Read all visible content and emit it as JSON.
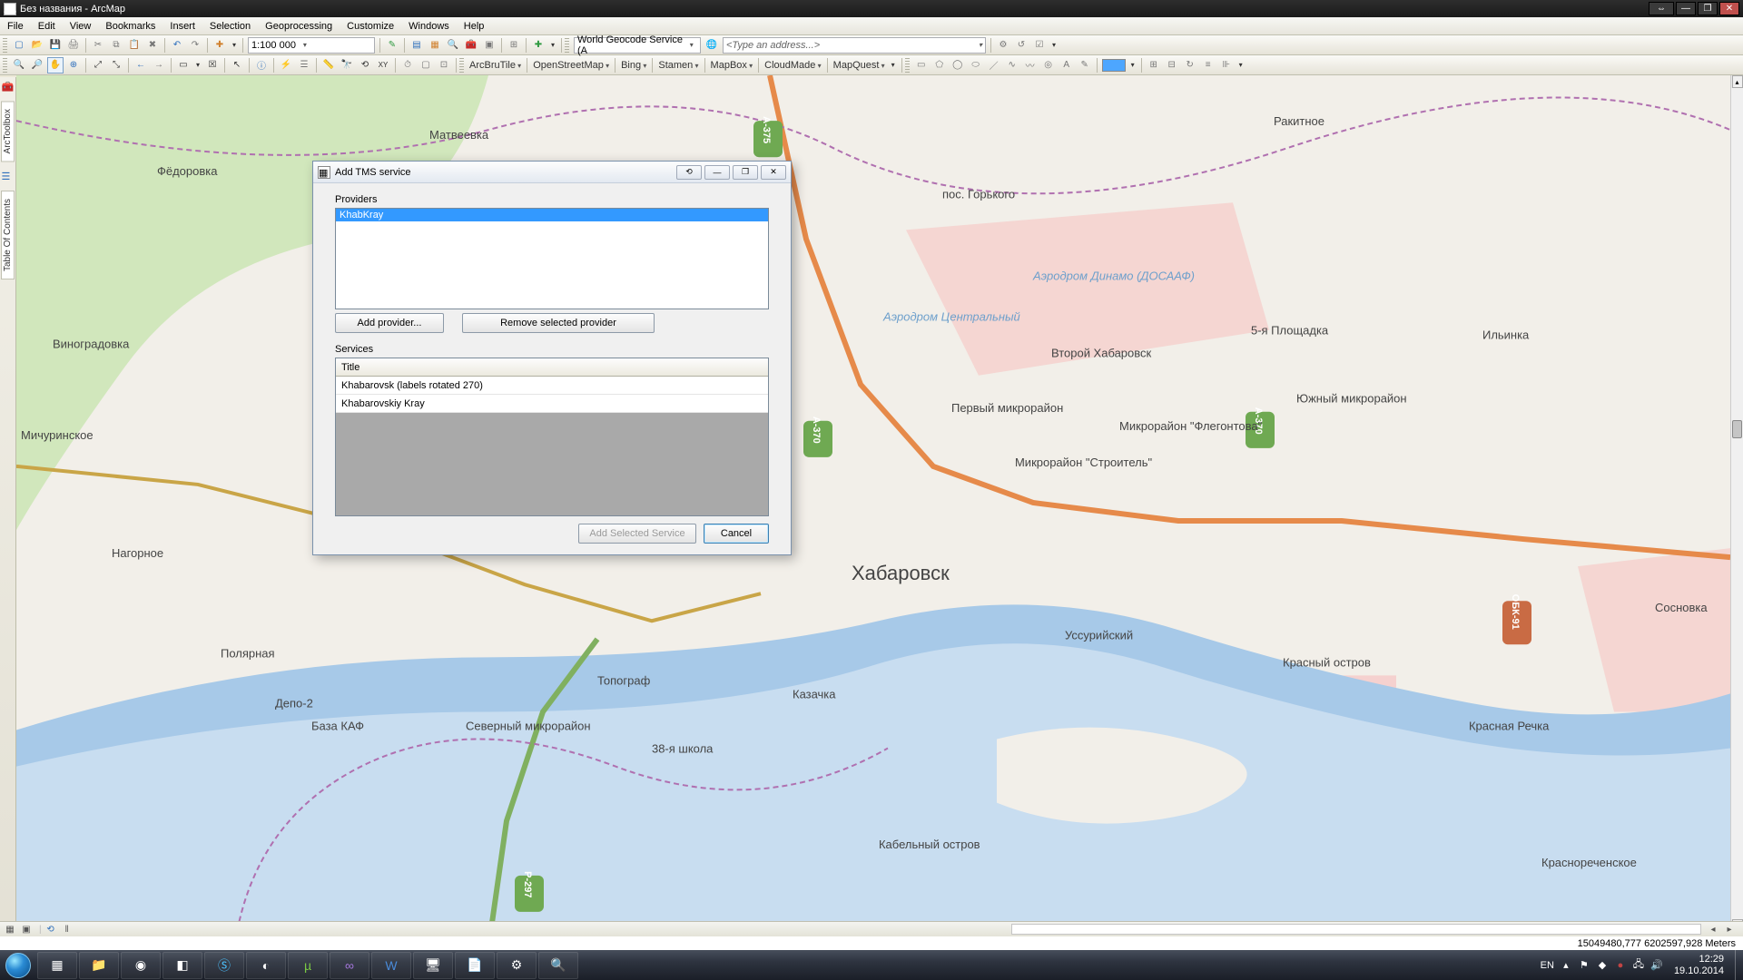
{
  "window": {
    "title": "Без названия - ArcMap"
  },
  "menubar": [
    "File",
    "Edit",
    "View",
    "Bookmarks",
    "Insert",
    "Selection",
    "Geoprocessing",
    "Customize",
    "Windows",
    "Help"
  ],
  "toolbar1": {
    "scale": "1:100 000",
    "geocode_service": "World Geocode Service (A",
    "address_placeholder": "<Type an address...>"
  },
  "toolbar2": {
    "menus": [
      "ArcBruTile",
      "OpenStreetMap",
      "Bing",
      "Stamen",
      "MapBox",
      "CloudMade",
      "MapQuest"
    ]
  },
  "side": {
    "tab1": "ArcToolbox",
    "tab2": "Table Of Contents"
  },
  "dialog": {
    "title": "Add TMS service",
    "providers_label": "Providers",
    "providers": [
      "KhabKray"
    ],
    "add_provider": "Add provider...",
    "remove_provider": "Remove selected provider",
    "services_label": "Services",
    "grid_header": "Title",
    "services": [
      "Khabarovsk (labels rotated 270)",
      "Khabarovskiy Kray"
    ],
    "add_selected": "Add Selected Service",
    "cancel": "Cancel"
  },
  "map_labels": {
    "city": "Хабаровск",
    "places": {
      "matveevka": "Матвеевка",
      "fedorovka": "Фёдоровка",
      "vinogradovka": "Виноградовка",
      "michurinskoe": "Мичуринское",
      "nagornoe": "Нагорное",
      "polyarnaya": "Полярная",
      "depo2": "Депо-2",
      "baza_kaf": "База КАФ",
      "severny": "Северный микрорайон",
      "school38": "38-я школа",
      "topograf": "Топограф",
      "kazachka": "Казачка",
      "ussuriyskiy": "Уссурийский",
      "kabelny": "Кабельный остров",
      "krasny_ostrov": "Красный остров",
      "krasnaya_rechka": "Красная Речка",
      "yuzhny": "Южный микрорайон",
      "flegontova": "Микрорайон \"Флегонтова\"",
      "stroitel": "Микрорайон \"Строитель\"",
      "pervy": "Первый микрорайон",
      "vtoroy": "Второй Хабаровск",
      "ploshchadka5": "5-я Площадка",
      "rakitnoe": "Ракитное",
      "ilinka": "Ильинка",
      "sosnovka": "Сосновка",
      "krasnorech": "Краснореченское",
      "gorkogo": "пос. Горького",
      "aero_central": "Аэродром Центральный",
      "aero_dinamo": "Аэродром Динамо (ДОСААФ)"
    },
    "roads": {
      "a370": "A-370",
      "a375": "A-375",
      "p297": "P-297",
      "obk91": "ОБК-91"
    }
  },
  "status": {
    "coords": "15049480,777   6202597,928 Meters"
  },
  "taskbar": {
    "lang": "EN",
    "time": "12:29",
    "date": "19.10.2014"
  }
}
